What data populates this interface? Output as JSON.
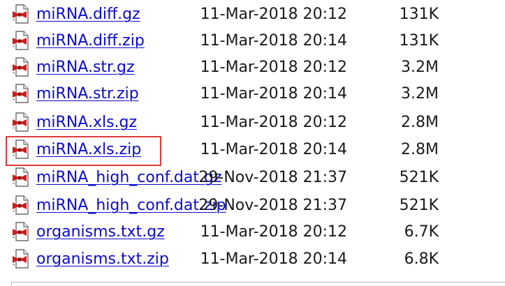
{
  "files": [
    {
      "name": "miRNA.diff.gz",
      "date": "11-Mar-2018 20:12",
      "size": "131K",
      "icon": "compressed-file-icon"
    },
    {
      "name": "miRNA.diff.zip",
      "date": "11-Mar-2018 20:14",
      "size": "131K",
      "icon": "compressed-file-icon"
    },
    {
      "name": "miRNA.str.gz",
      "date": "11-Mar-2018 20:12",
      "size": "3.2M",
      "icon": "compressed-file-icon"
    },
    {
      "name": "miRNA.str.zip",
      "date": "11-Mar-2018 20:14",
      "size": "3.2M",
      "icon": "compressed-file-icon"
    },
    {
      "name": "miRNA.xls.gz",
      "date": "11-Mar-2018 20:12",
      "size": "2.8M",
      "icon": "compressed-file-icon"
    },
    {
      "name": "miRNA.xls.zip",
      "date": "11-Mar-2018 20:14",
      "size": "2.8M",
      "icon": "compressed-file-icon",
      "highlighted": true
    },
    {
      "name": "miRNA_high_conf.dat.gz",
      "date": "29-Nov-2018 21:37",
      "size": "521K",
      "icon": "compressed-file-icon"
    },
    {
      "name": "miRNA_high_conf.dat.zip",
      "date": "29-Nov-2018 21:37",
      "size": "521K",
      "icon": "compressed-file-icon"
    },
    {
      "name": "organisms.txt.gz",
      "date": "11-Mar-2018 20:12",
      "size": "6.7K",
      "icon": "compressed-file-icon"
    },
    {
      "name": "organisms.txt.zip",
      "date": "11-Mar-2018 20:14",
      "size": "6.8K",
      "icon": "compressed-file-icon"
    }
  ],
  "colors": {
    "link": "#0b0bcc",
    "text": "#1a1a1a",
    "highlight": "#e03a3a",
    "icon_red": "#d21b1b"
  }
}
